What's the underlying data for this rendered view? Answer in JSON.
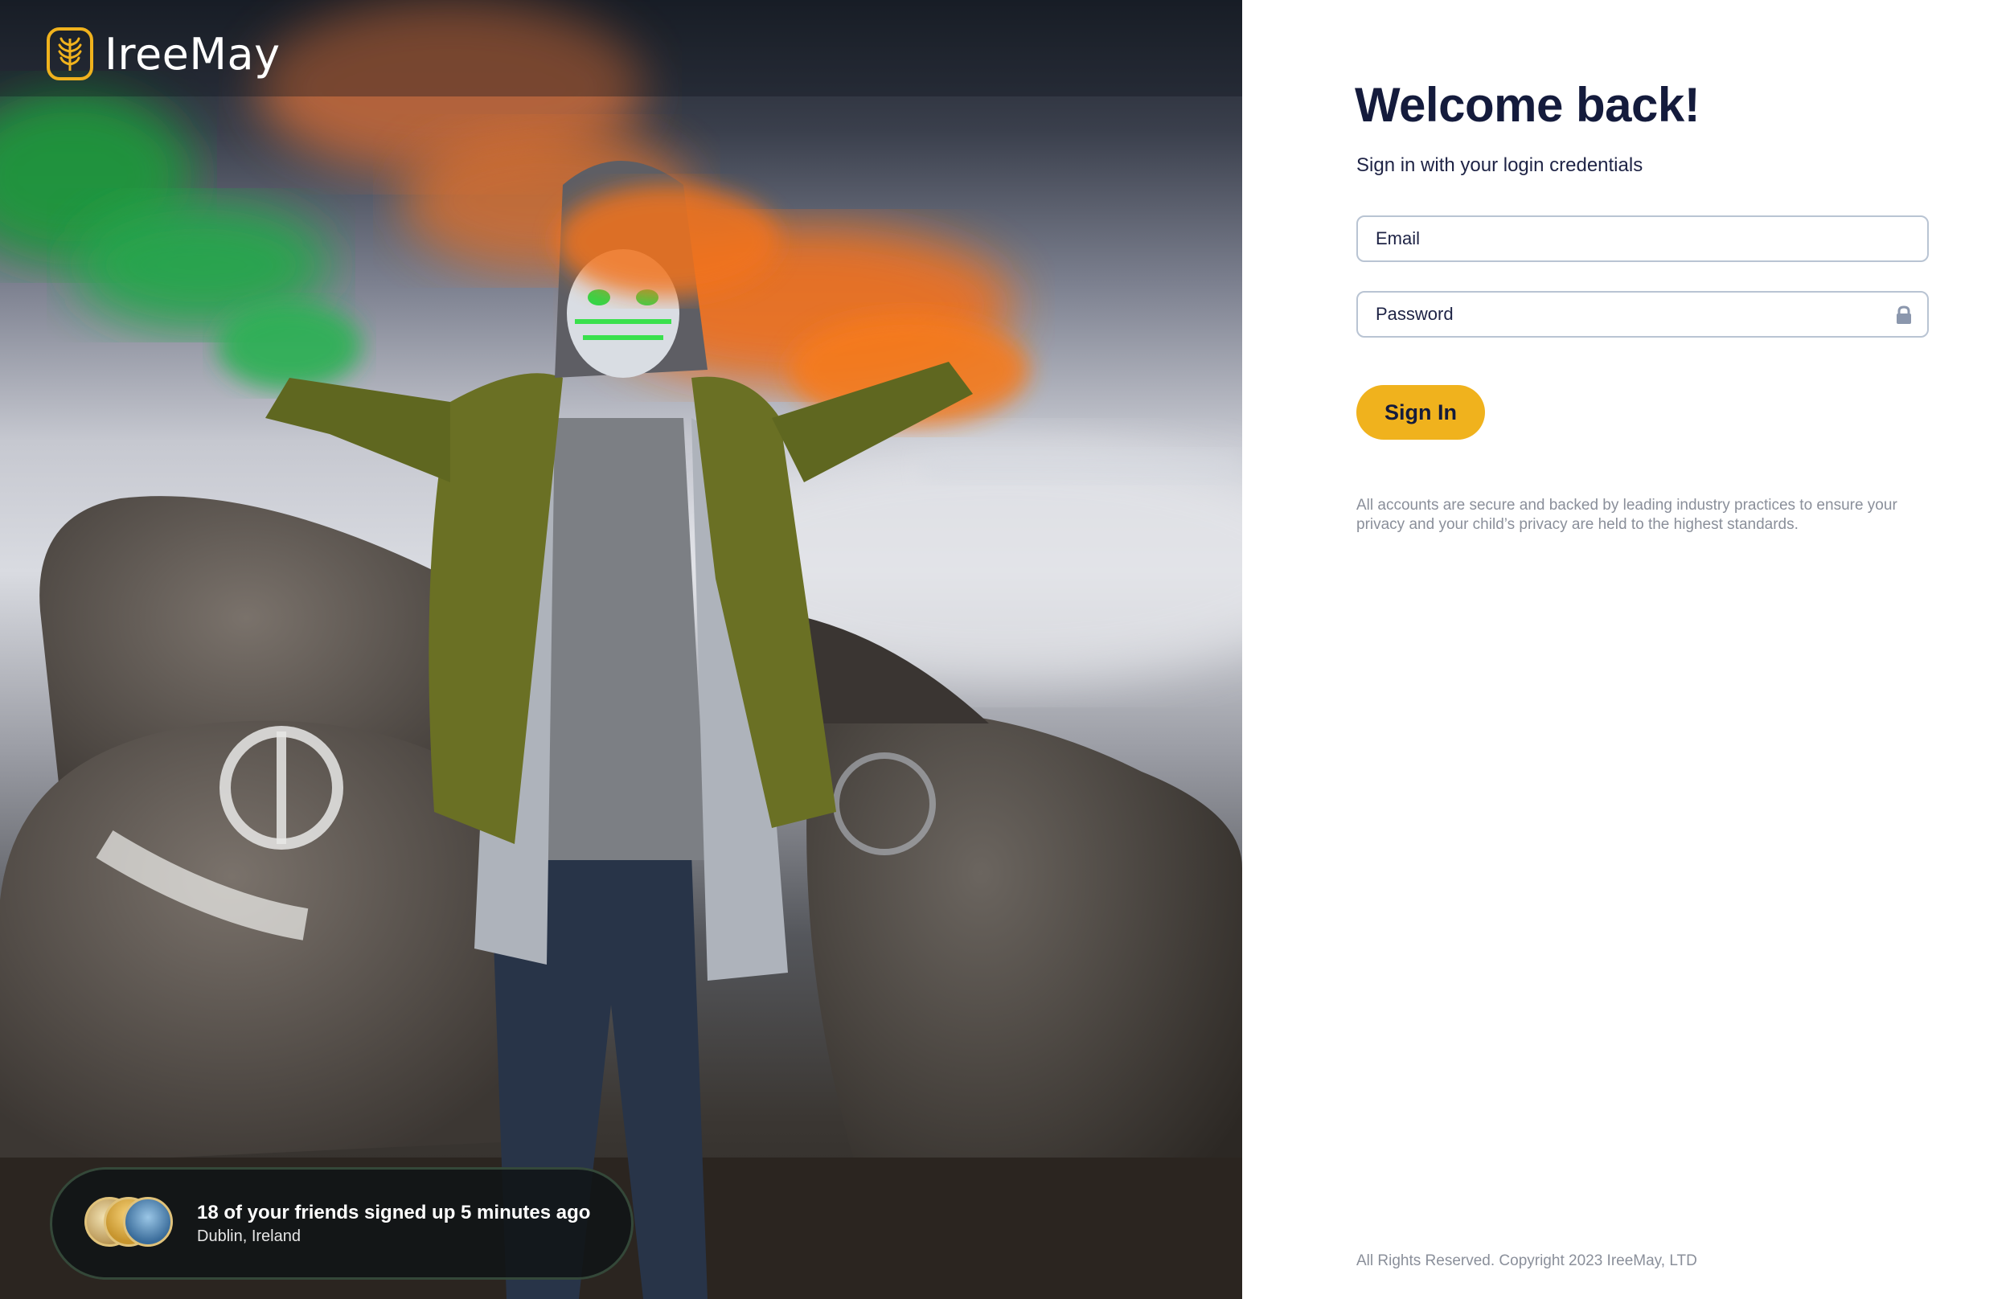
{
  "brand": {
    "name": "IreeMay",
    "logo_icon": "wheat-icon",
    "accent": "#f0b21d"
  },
  "hero": {
    "image_alt": "Person in hood and glowing mask holding green and orange smoke flares on rocks",
    "toast": {
      "title": "18 of your friends signed up 5 minutes ago",
      "location": "Dublin, Ireland",
      "avatar_count": 3
    }
  },
  "login": {
    "heading": "Welcome back!",
    "subheading": "Sign in with your login credentials",
    "email": {
      "placeholder": "Email",
      "value": ""
    },
    "password": {
      "placeholder": "Password",
      "value": "",
      "icon": "lock-icon"
    },
    "submit_label": "Sign In",
    "notice": "All accounts are secure and backed by leading industry practices to ensure your privacy and your child’s privacy are held to the highest standards."
  },
  "footer": {
    "copyright": "All Rights Reserved. Copyright 2023 IreeMay, LTD"
  },
  "colors": {
    "heading": "#141b3c",
    "button": "#f0b21d",
    "muted": "#8a8f9a",
    "field_border": "#b9c4d3"
  }
}
